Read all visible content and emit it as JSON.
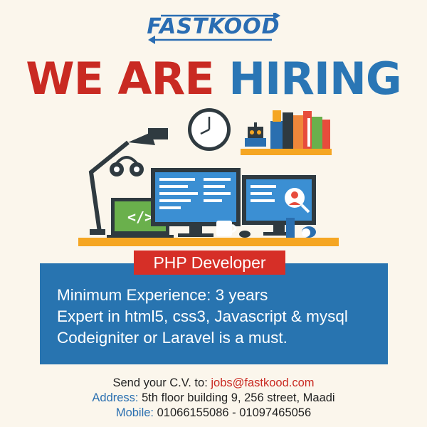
{
  "brand": {
    "name": "FASTKOOD"
  },
  "headline": {
    "word1": "WE ARE",
    "word2": "HIRING"
  },
  "job": {
    "title": "PHP Developer",
    "requirements": [
      "Minimum Experience: 3 years",
      "Expert in html5, css3, Javascript & mysql",
      "Codeigniter or Laravel is a must."
    ]
  },
  "contact": {
    "cv_label": "Send your C.V. to: ",
    "email": "jobs@fastkood.com",
    "address_label": "Address: ",
    "address": "5th floor building 9, 256 street, Maadi",
    "mobile_label": "Mobile: ",
    "mobile": "01066155086 - 01097465056"
  },
  "illustration": {
    "code_icon": "</>"
  },
  "colors": {
    "red": "#c92a22",
    "blue": "#2a76b5",
    "background": "#fbf6ec",
    "desk": "#f5a623"
  }
}
